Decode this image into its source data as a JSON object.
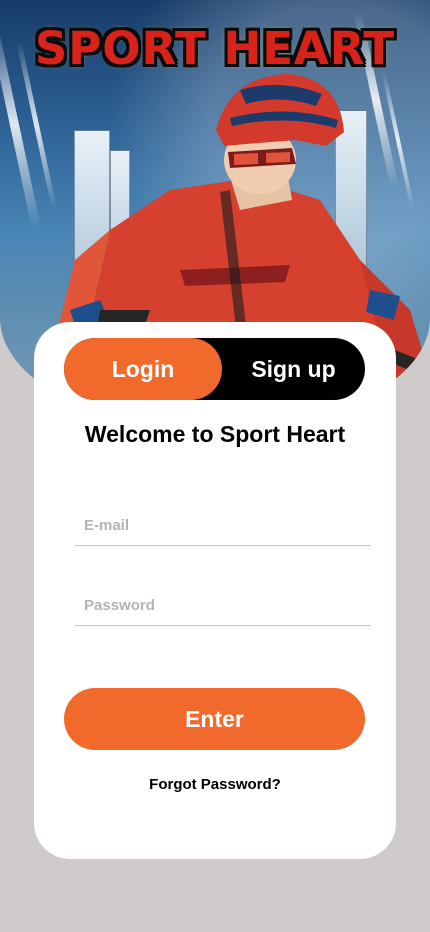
{
  "app": {
    "logo_text": "SPORT HEART"
  },
  "auth": {
    "tabs": [
      {
        "label": "Login",
        "active": true
      },
      {
        "label": "Sign up",
        "active": false
      }
    ]
  },
  "welcome": {
    "title": "Welcome to Sport Heart"
  },
  "form": {
    "email_placeholder": "E-mail",
    "email_value": "",
    "password_placeholder": "Password",
    "password_value": "",
    "submit_label": "Enter",
    "forgot_label": "Forgot Password?"
  },
  "colors": {
    "accent": "#f26a2b",
    "toggle_bg": "#000000",
    "page_bg": "#cfcbcb",
    "card_bg": "#ffffff",
    "logo_red": "#d8231b"
  },
  "icons": {
    "hero": "cyclist-illustration"
  }
}
